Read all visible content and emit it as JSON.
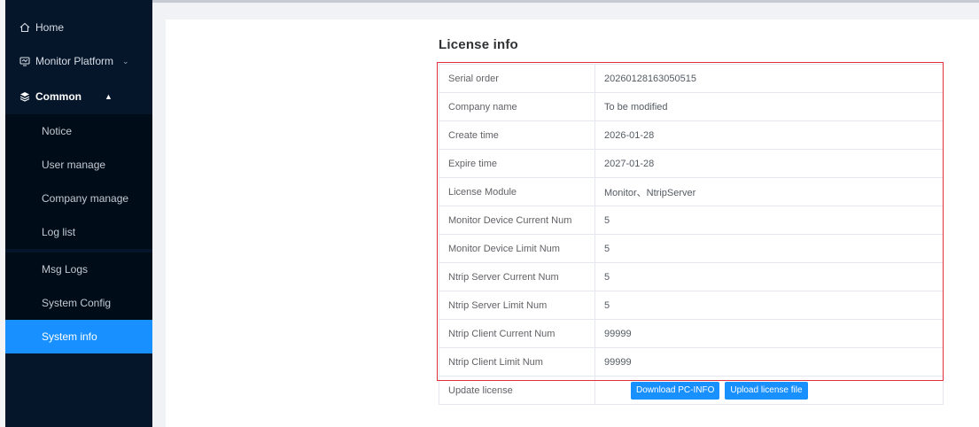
{
  "sidebar": {
    "items": [
      {
        "label": "Home",
        "icon": "home-icon"
      },
      {
        "label": "Monitor Platform",
        "icon": "monitor-icon",
        "chevron": "⌄"
      },
      {
        "label": "Common",
        "icon": "layers-icon",
        "chevron": "▲"
      }
    ],
    "sub_items": [
      {
        "label": "Notice"
      },
      {
        "label": "User manage"
      },
      {
        "label": "Company manage"
      },
      {
        "label": "Log list"
      },
      {
        "label": "Msg Logs"
      },
      {
        "label": "System Config"
      },
      {
        "label": "System info",
        "active": true
      }
    ]
  },
  "main": {
    "title": "License info",
    "rows": [
      {
        "key": "Serial order",
        "value": "20260128163050515"
      },
      {
        "key": "Company name",
        "value": "To be modified"
      },
      {
        "key": "Create time",
        "value": "2026-01-28"
      },
      {
        "key": "Expire time",
        "value": "2027-01-28"
      },
      {
        "key": "License Module",
        "value": "Monitor、NtripServer"
      },
      {
        "key": "Monitor Device Current Num",
        "value": "5"
      },
      {
        "key": "Monitor Device Limit Num",
        "value": "5"
      },
      {
        "key": "Ntrip Server Current Num",
        "value": "5"
      },
      {
        "key": "Ntrip Server Limit Num",
        "value": "5"
      },
      {
        "key": "Ntrip Client Current Num",
        "value": "99999"
      },
      {
        "key": "Ntrip Client Limit Num",
        "value": "99999"
      }
    ],
    "update": {
      "label": "Update license",
      "download_button": "Download PC-INFO",
      "upload_button": "Upload license file"
    }
  },
  "colors": {
    "sidebar_bg": "#05162b",
    "submenu_bg": "#000c17",
    "active": "#1890ff",
    "highlight_border": "#e0303d"
  }
}
